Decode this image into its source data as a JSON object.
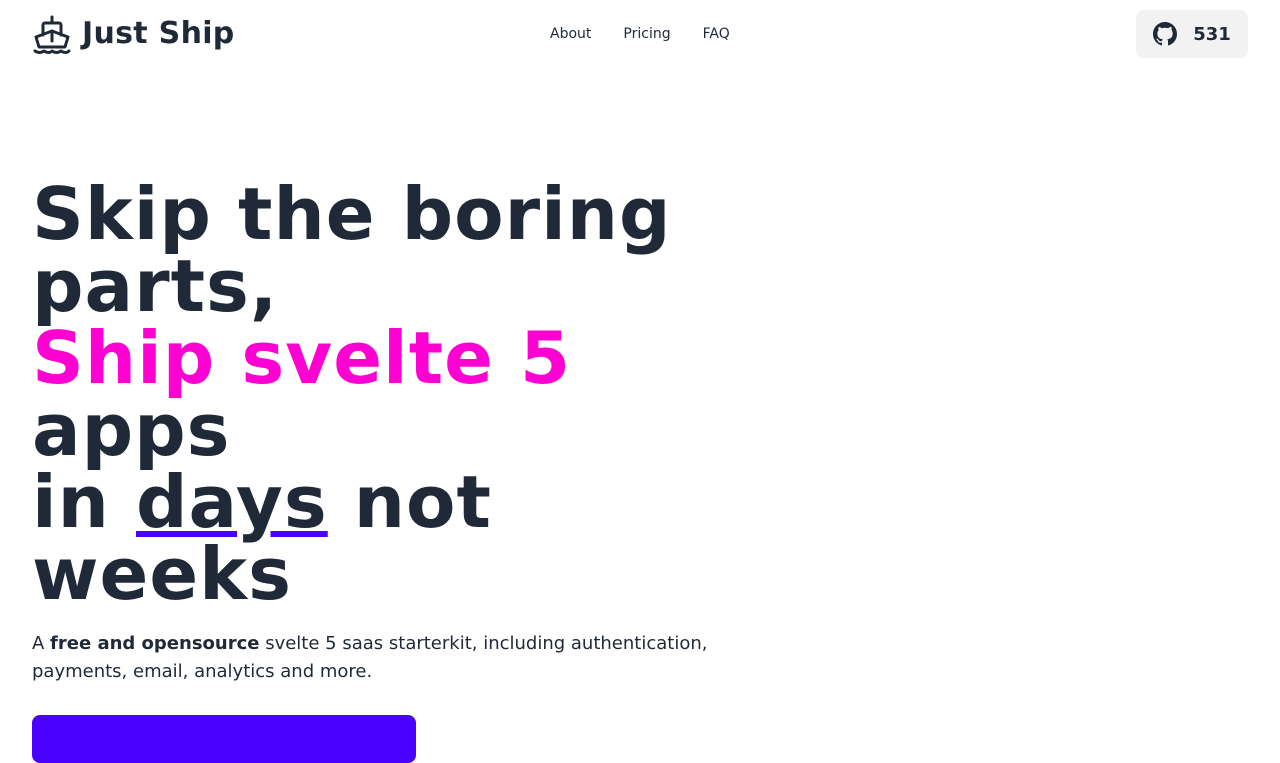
{
  "brand": {
    "name": "Just Ship"
  },
  "nav": {
    "links": [
      {
        "label": "About"
      },
      {
        "label": "Pricing"
      },
      {
        "label": "FAQ"
      }
    ]
  },
  "github": {
    "star_count": "531"
  },
  "hero": {
    "title_line1": "Skip the boring",
    "title_line2": "parts,",
    "title_accent": "Ship svelte 5",
    "title_line4": "apps",
    "title_in": "in ",
    "title_days": "days",
    "title_not": " not",
    "title_weeks": "weeks",
    "subtitle_prefix": "A ",
    "subtitle_bold": "free and opensource",
    "subtitle_rest": " svelte 5 saas starterkit, including authentication, payments, email, analytics and more."
  },
  "colors": {
    "text": "#1f2937",
    "accent_pink": "#ff00d3",
    "primary_purple": "#4a00ff",
    "github_button_bg": "#f2f2f2"
  },
  "icons": {
    "brand": "ship-icon",
    "github": "github-icon"
  }
}
